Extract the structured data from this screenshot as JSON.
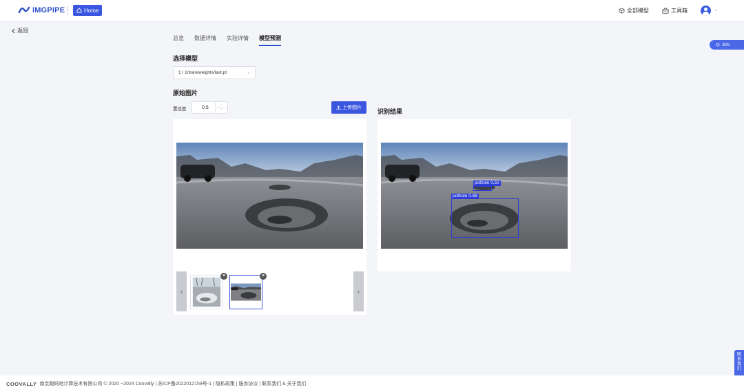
{
  "header": {
    "brand": "iMGPiPE",
    "home_label": "Home",
    "nav": {
      "models": "全部模型",
      "toolbox": "工具箱"
    },
    "icons": {
      "logo": "imgpipe-logo",
      "home": "home-icon",
      "models": "cube-icon",
      "toolbox": "briefcase-icon",
      "avatar": "user-avatar-icon",
      "caret": "chevron-down-icon"
    }
  },
  "back_label": "返回",
  "tabs": [
    {
      "label": "总览",
      "active": false
    },
    {
      "label": "数据详情",
      "active": false
    },
    {
      "label": "实验详情",
      "active": false
    },
    {
      "label": "模型预测",
      "active": true
    }
  ],
  "timer_label": "30s",
  "model_section": {
    "title": "选择模型",
    "selected": "1 / 1/train/weights/last.pt"
  },
  "original_section": {
    "title": "原始图片",
    "confidence_label": "置信度",
    "confidence_value": "0.5",
    "upload_label": "上传图片"
  },
  "result_section": {
    "title": "识别结果",
    "detections": [
      {
        "label": "pothole  0.50"
      },
      {
        "label": "pothole  0.88"
      }
    ]
  },
  "thumbnails": [
    {
      "name": "road-puddle-image",
      "selected": false
    },
    {
      "name": "road-pothole-image",
      "selected": true
    }
  ],
  "contact_label": "联系我们",
  "footer": {
    "brand": "COOVALLY",
    "text": "南京跑码地计算技术有限公司 © 2020 ~2024 Coovally | 苏ICP备2022012159号-1 | 隐私政策 | 服务协议 | 联系我们 & 关于我们"
  },
  "colors": {
    "accent": "#3b57e0",
    "detection_box": "#2a3dd8",
    "background": "#f4f5f8"
  }
}
